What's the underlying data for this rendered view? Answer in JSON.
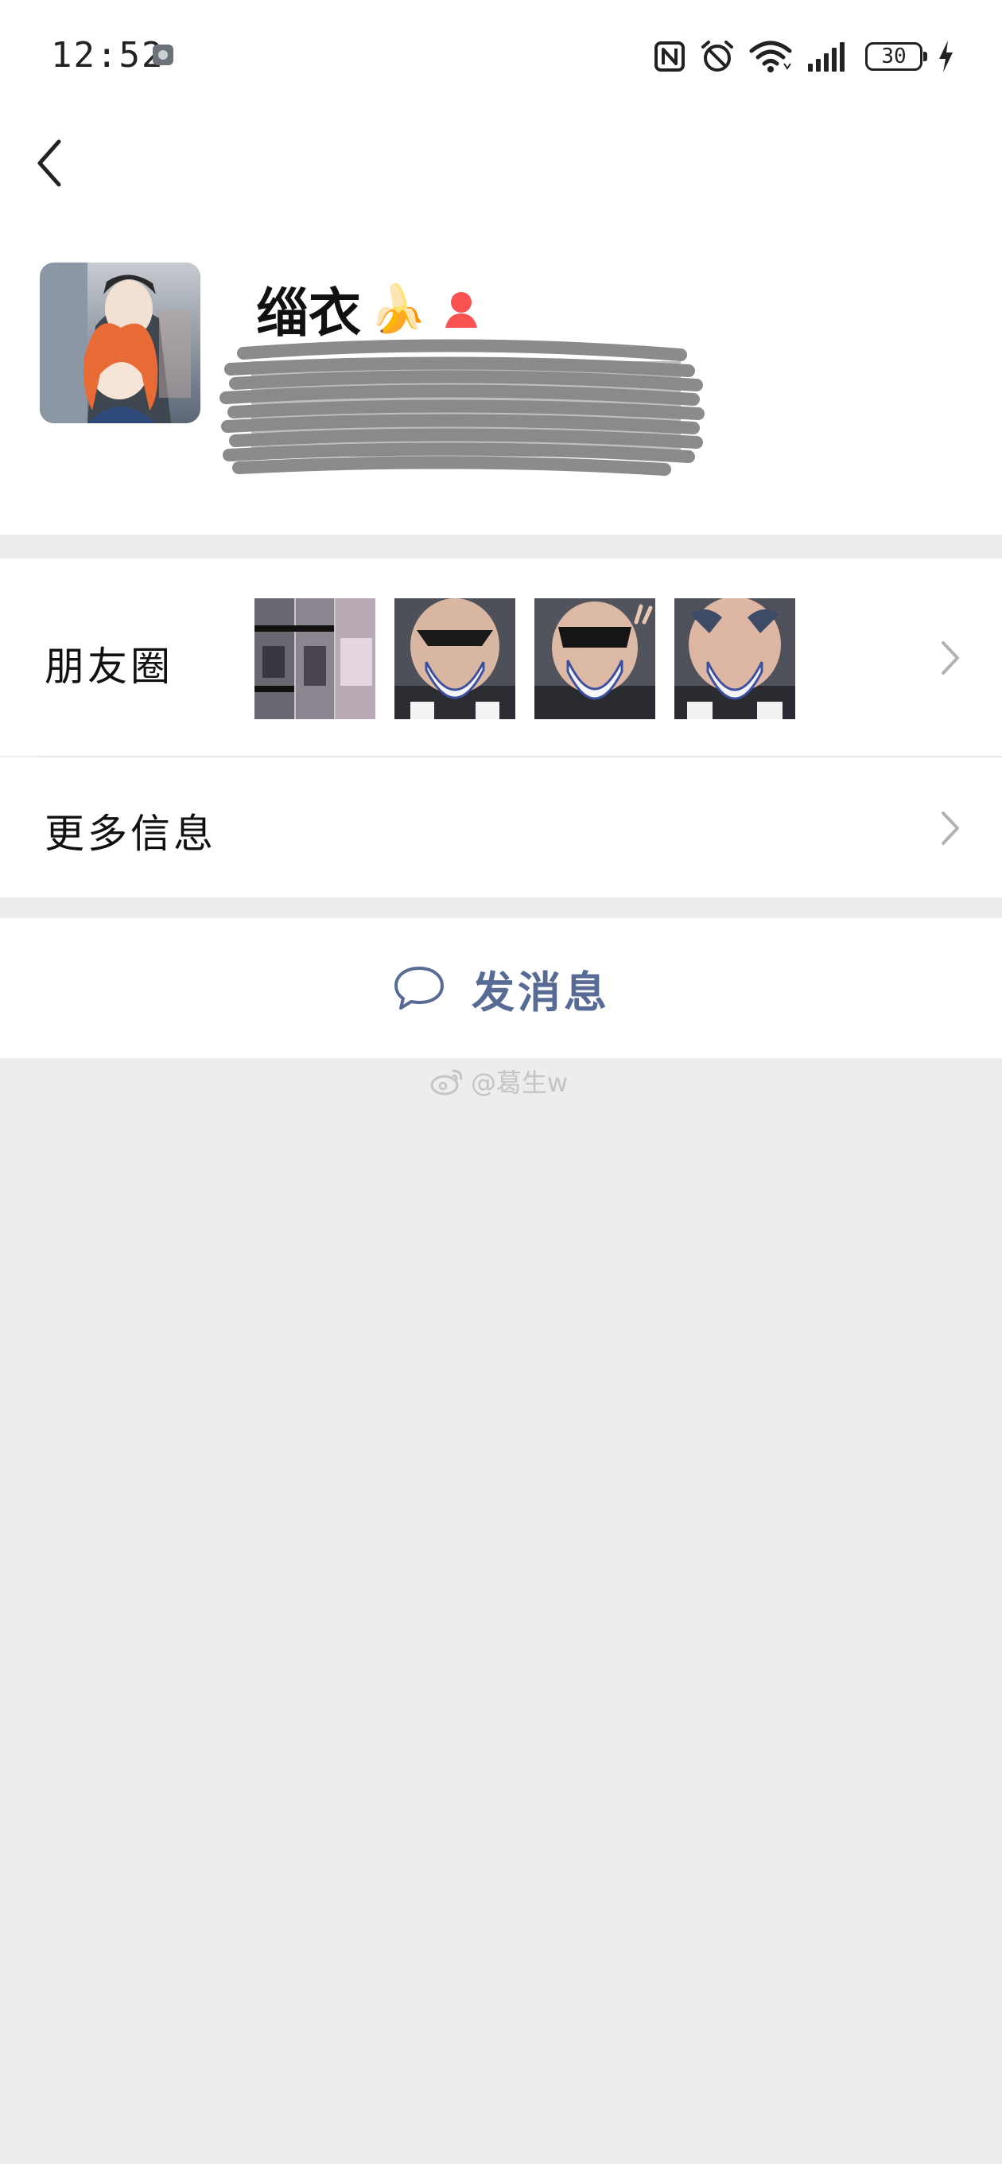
{
  "status_bar": {
    "time": "12:52",
    "battery_level": "30",
    "icons": [
      "app-notification-icon",
      "nfc-icon",
      "alarm-icon",
      "wifi-icon",
      "signal-icon",
      "battery-icon",
      "charging-icon"
    ]
  },
  "nav": {
    "back_icon": "back-chevron-icon"
  },
  "profile": {
    "nickname": "缁衣",
    "nickname_emoji": "🍌",
    "gender_icon": "female-icon",
    "gender_color": "#fa5151"
  },
  "moments": {
    "label": "朋友圈",
    "thumbnail_count": 4
  },
  "more_info": {
    "label": "更多信息"
  },
  "message": {
    "label": "发消息",
    "icon": "chat-bubble-icon",
    "color": "#576b95"
  },
  "watermark": {
    "text": "@葛生w",
    "icon": "weibo-icon"
  }
}
